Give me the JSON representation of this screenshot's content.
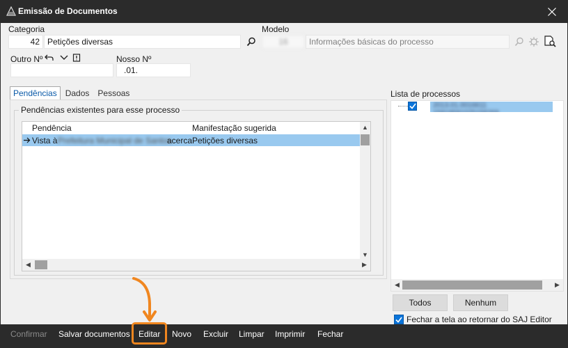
{
  "window": {
    "title": "Emissão de Documentos"
  },
  "form": {
    "categoria_label": "Categoria",
    "categoria_code": "42",
    "categoria_value": "Petições diversas",
    "modelo_label": "Modelo",
    "modelo_code": "16",
    "modelo_value": "Informações básicas do processo",
    "outro_label": "Outro Nº",
    "outro_value": "",
    "nosso_label": "Nosso Nº",
    "nosso_value": ".01."
  },
  "tabs": [
    {
      "label": "Pendências",
      "active": true
    },
    {
      "label": "Dados",
      "active": false
    },
    {
      "label": "Pessoas",
      "active": false
    }
  ],
  "pendencias": {
    "group_title": "Pendências existentes para esse processo",
    "columns": [
      "Pendência",
      "Manifestação sugerida"
    ],
    "rows": [
      {
        "pendencia_prefix": "Vista à",
        "pendencia_blur": "Prefeitura Municipal de Santos",
        "pendencia_suffix": "acerca",
        "manifestacao": "Petições diversas"
      }
    ]
  },
  "processos": {
    "label": "Lista de processos",
    "items": [
      {
        "number": "2013.01.0016611 15819581025158269",
        "checked": true
      }
    ]
  },
  "buttons": {
    "todos": "Todos",
    "nenhum": "Nenhum",
    "fechar_checkbox": "Fechar a tela ao retornar do SAJ Editor"
  },
  "bottom": {
    "confirmar": "Confirmar",
    "salvar": "Salvar documentos",
    "editar": "Editar",
    "novo": "Novo",
    "excluir": "Excluir",
    "limpar": "Limpar",
    "imprimir": "Imprimir",
    "fechar": "Fechar"
  },
  "colors": {
    "accent": "#0a74da",
    "selection": "#99c9ef",
    "highlight": "#f0861f",
    "chrome": "#2b2b2b"
  }
}
